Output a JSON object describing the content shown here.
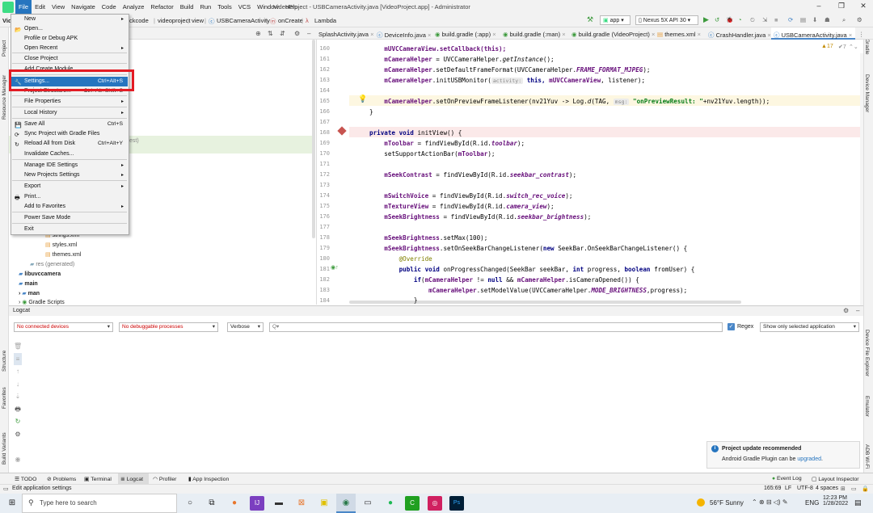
{
  "menubar": {
    "items": [
      "File",
      "Edit",
      "View",
      "Navigate",
      "Code",
      "Analyze",
      "Refactor",
      "Build",
      "Run",
      "Tools",
      "VCS",
      "Window",
      "Help"
    ],
    "title": "VideoProject - USBCameraActivity.java [VideoProject.app] - Administrator"
  },
  "navbar": {
    "crumbs": [
      "ckcode",
      "videoproject",
      "view",
      "USBCameraActivity",
      "onCreate",
      "Lambda"
    ],
    "run_config": "app",
    "device": "Nexus 5X API 30"
  },
  "tabs": [
    "SplashActivity.java",
    "DeviceInfo.java",
    "build.gradle (:app)",
    "build.gradle (:man)",
    "build.gradle (VideoProject)",
    "themes.xml",
    "CrashHandler.java",
    "USBCameraActivity.java"
  ],
  "inspection": {
    "warnings": "17",
    "weak": "7"
  },
  "file_menu": {
    "items": [
      {
        "label": "New",
        "arrow": "▸",
        "icon": ""
      },
      {
        "label": "Open...",
        "icon": "📂"
      },
      {
        "label": "Profile or Debug APK"
      },
      {
        "label": "Open Recent",
        "arrow": "▸"
      },
      {
        "label": "Close Project"
      },
      {
        "label": "Add Create Module..."
      },
      {
        "label": "Settings...",
        "shortcut": "Ctrl+Alt+S",
        "icon": "🔧",
        "selected": true
      },
      {
        "label": "Project Structure...",
        "shortcut": "Ctrl+Alt+Shift+S"
      },
      {
        "label": "File Properties",
        "arrow": "▸"
      },
      {
        "label": "Local History",
        "arrow": "▸"
      },
      {
        "label": "Save All",
        "shortcut": "Ctrl+S",
        "icon": "💾"
      },
      {
        "label": "Sync Project with Gradle Files",
        "icon": "⟳"
      },
      {
        "label": "Reload All from Disk",
        "shortcut": "Ctrl+Alt+Y",
        "icon": "↻"
      },
      {
        "label": "Invalidate Caches..."
      },
      {
        "label": "Manage IDE Settings",
        "arrow": "▸"
      },
      {
        "label": "New Projects Settings",
        "arrow": "▸"
      },
      {
        "label": "Export",
        "arrow": "▸"
      },
      {
        "label": "Print...",
        "icon": "🖶"
      },
      {
        "label": "Add to Favorites",
        "arrow": "▸"
      },
      {
        "label": "Power Save Mode"
      },
      {
        "label": "Exit"
      }
    ]
  },
  "project_tree": {
    "ghost_text": "est)",
    "items": [
      "strings.xml",
      "styles.xml",
      "themes.xml",
      "res (generated)",
      "libuvccamera",
      "main",
      "man",
      "Gradle Scripts"
    ]
  },
  "editor": {
    "line_numbers": [
      "160",
      "161",
      "162",
      "163",
      "164",
      "165",
      "166",
      "167",
      "168",
      "169",
      "170",
      "171",
      "172",
      "173",
      "174",
      "175",
      "176",
      "177",
      "178",
      "179",
      "180",
      "181",
      "182",
      "183",
      "184"
    ],
    "lines": {
      "l160": "mUVCCameraView.setCallback(this);",
      "l161a": "mCameraHelper",
      "l161b": " = UVCCameraHelper.",
      "l161c": "getInstance",
      "l161d": "();",
      "l162a": "mCameraHelper",
      "l162b": ".setDefaultFrameFormat(UVCCameraHelper.",
      "l162c": "FRAME_FORMAT_MJPEG",
      "l162d": ");",
      "l163a": "mCameraHelper",
      "l163b": ".initUSBMonitor(",
      "l163hint": "activity:",
      "l163c": " this, ",
      "l163d": "mUVCCameraView",
      "l163e": ", listener);",
      "l165a": "mCameraHelper",
      "l165b": ".setOnPreviewFrameListener(nv21Yuv -> Log.",
      "l165c": "d",
      "l165d": "(TAG, ",
      "l165hint": "msg:",
      "l165e": " \"onPreviewResult: \"",
      "l165f": "+nv21Yuv.length));",
      "l167": "}",
      "l169a": "private void ",
      "l169b": "initView() {",
      "l170a": "mToolbar",
      "l170b": " = findViewById(R.id.",
      "l170c": "toolbar",
      "l170d": ");",
      "l171a": "setSupportActionBar(",
      "l171b": "mToolbar",
      "l171c": ");",
      "l173a": "mSeekContrast",
      "l173b": " = findViewById(R.id.",
      "l173c": "seekbar_contrast",
      "l173d": ");",
      "l175a": "mSwitchVoice",
      "l175b": " = findViewById(R.id.",
      "l175c": "switch_rec_voice",
      "l175d": ");",
      "l176a": "mTextureView",
      "l176b": " = findViewById(R.id.",
      "l176c": "camera_view",
      "l176d": ");",
      "l177a": "mSeekBrightness",
      "l177b": " = findViewById(R.id.",
      "l177c": "seekbar_brightness",
      "l177d": ");",
      "l179a": "mSeekBrightness",
      "l179b": ".setMax(100);",
      "l180a": "mSeekBrightness",
      "l180b": ".setOnSeekBarChangeListener(",
      "l180c": "new ",
      "l180d": "SeekBar.OnSeekBarChangeListener() {",
      "l181": "@Override",
      "l182a": "public void ",
      "l182b": "onProgressChanged(SeekBar seekBar, ",
      "l182c": "int ",
      "l182d": "progress, ",
      "l182e": "boolean ",
      "l182f": "fromUser) {",
      "l183a": "if",
      "l183b": "(",
      "l183c": "mCameraHelper",
      "l183d": " != ",
      "l183e": "null ",
      "l183f": "&& ",
      "l183g": "mCameraHelper",
      "l183h": ".isCameraOpened()) {",
      "l184a": "mCameraHelper",
      "l184b": ".setModelValue(UVCCameraHelper.",
      "l184c": "MODE_BRIGHTNESS",
      "l184d": ",progress);",
      "l185": "}"
    }
  },
  "logcat": {
    "title": "Logcat",
    "device": "No connected devices",
    "process": "No debuggable processes",
    "level": "Verbose",
    "search_placeholder": "Q▾",
    "regex_label": "Regex",
    "filter": "Show only selected application"
  },
  "side_labels": {
    "left": [
      "Project",
      "Resource Manager",
      "Structure",
      "Favorites",
      "Build Variants"
    ],
    "right": [
      "Gradle",
      "Device Manager",
      "Device File Explorer",
      "Emulator",
      "ADB Wi-Fi"
    ]
  },
  "bottom_tools": [
    "TODO",
    "Problems",
    "Terminal",
    "Logcat",
    "Profiler",
    "App Inspection"
  ],
  "right_tools": [
    "Event Log",
    "Layout Inspector"
  ],
  "status": {
    "message": "Edit application settings",
    "position": "165:69",
    "line_sep": "LF",
    "encoding": "UTF-8",
    "indent": "4 spaces"
  },
  "notification": {
    "title": "Project update recommended",
    "body": "Android Gradle Plugin can be ",
    "link": "upgraded",
    "tail": "."
  },
  "taskbar": {
    "search_placeholder": "Type here to search",
    "weather": "56°F  Sunny",
    "lang": "ENG",
    "time": "12:23 PM",
    "date": "1/28/2022"
  }
}
